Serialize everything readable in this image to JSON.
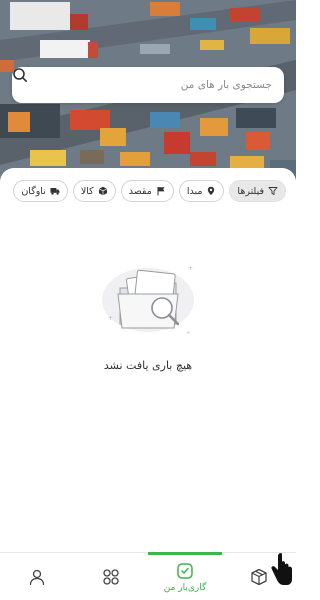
{
  "search": {
    "placeholder": "جستجوی بار های من"
  },
  "filters": {
    "chips": [
      {
        "label": "فیلترها",
        "icon": "funnel-icon",
        "active": true
      },
      {
        "label": "مبدا",
        "icon": "map-pin-icon"
      },
      {
        "label": "مقصد",
        "icon": "flag-icon"
      },
      {
        "label": "کالا",
        "icon": "box-icon"
      },
      {
        "label": "ناوگان",
        "icon": "truck-icon"
      }
    ]
  },
  "empty_state": {
    "message": "هیچ باری یافت نشد",
    "icon": "empty-folder-search-icon"
  },
  "bottom_nav": {
    "items": [
      {
        "name": "box-cube",
        "icon": "cube-icon",
        "label": ""
      },
      {
        "name": "my-loads",
        "icon": "my-loads-icon",
        "label": "گاری‌بار من",
        "active": true
      },
      {
        "name": "grid",
        "icon": "grid-icon",
        "label": ""
      },
      {
        "name": "profile",
        "icon": "user-icon",
        "label": ""
      }
    ]
  },
  "colors": {
    "accent": "#3cb54a",
    "chip_active_bg": "#e8e8e8"
  }
}
